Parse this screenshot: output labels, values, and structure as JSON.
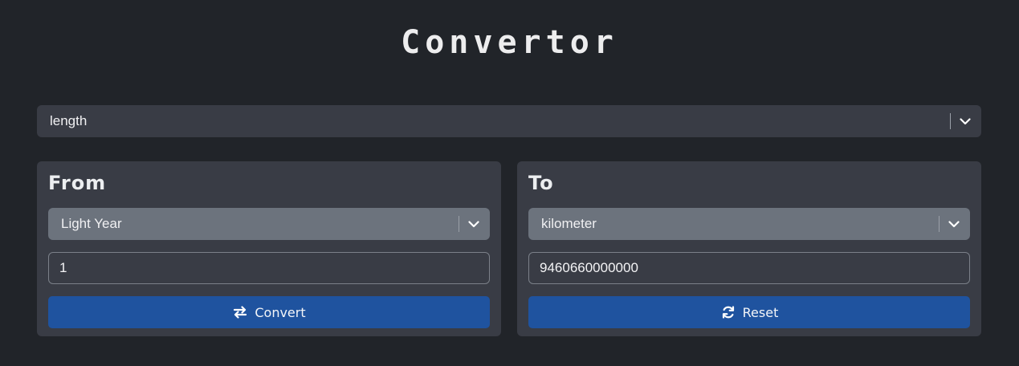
{
  "app": {
    "title": "Convertor"
  },
  "category": {
    "selected": "length",
    "icon": "chevron-down-icon"
  },
  "from": {
    "heading": "From",
    "unit": "Light Year",
    "value": "1",
    "button_label": "Convert",
    "button_icon": "swap-arrows-icon"
  },
  "to": {
    "heading": "To",
    "unit": "kilometer",
    "value": "9460660000000",
    "button_label": "Reset",
    "button_icon": "refresh-icon"
  },
  "colors": {
    "background": "#212429",
    "panel": "#393c45",
    "unit_select": "#6c737d",
    "button": "#1f539f"
  }
}
